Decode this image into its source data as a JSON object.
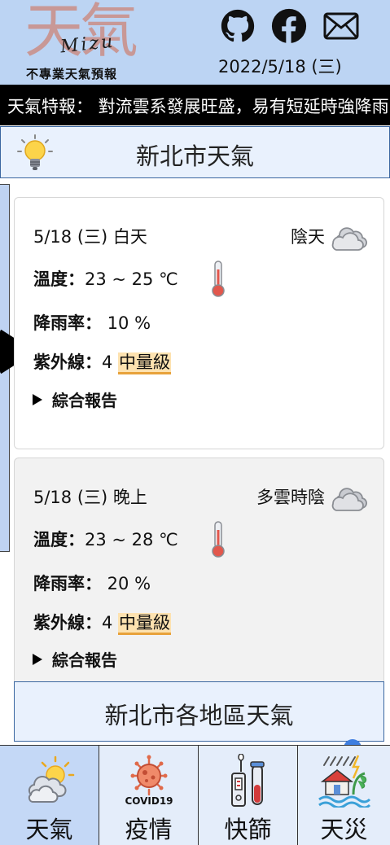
{
  "header": {
    "logo_big": "天氣",
    "logo_script": "Mizu",
    "logo_sub": "不專業天氣預報",
    "date": "2022/5/18 (三)",
    "icons": [
      "github-icon",
      "facebook-icon",
      "mail-icon"
    ]
  },
  "ticker": {
    "text": "天氣特報： 對流雲系發展旺盛，易有短延時強降雨"
  },
  "city": {
    "title": "新北市天氣",
    "icon": "lightbulb-icon"
  },
  "cards": [
    {
      "date": "5/18 (三) 白天",
      "weather": "陰天",
      "temp_label": "溫度：",
      "temp_value": "23 ~ 25 ℃",
      "rain_label": "降雨率：",
      "rain_value": " 10 %",
      "uv_label": "紫外線：",
      "uv_value": "4 ",
      "uv_level": "中量級",
      "report": "綜合報告"
    },
    {
      "date": "5/18 (三) 晚上",
      "weather": "多雲時陰",
      "temp_label": "溫度：",
      "temp_value": "23 ~ 28 ℃",
      "rain_label": "降雨率：",
      "rain_value": " 20 %",
      "uv_label": "紫外線：",
      "uv_value": "4 ",
      "uv_level": "中量級",
      "report": "綜合報告"
    }
  ],
  "region": {
    "title": "新北市各地區天氣"
  },
  "nav": [
    {
      "label": "天氣",
      "icon": "weather-icon",
      "active": true
    },
    {
      "label": "疫情",
      "icon": "covid19-icon",
      "badge": "COVID19"
    },
    {
      "label": "快篩",
      "icon": "rapid-test-icon"
    },
    {
      "label": "天災",
      "icon": "disaster-icon"
    }
  ],
  "colors": {
    "header_bg": "#bcd4f3",
    "ticker_bg": "#000000",
    "uv_highlight": "#fde2b0",
    "nav_active": "#c4d8f6"
  }
}
